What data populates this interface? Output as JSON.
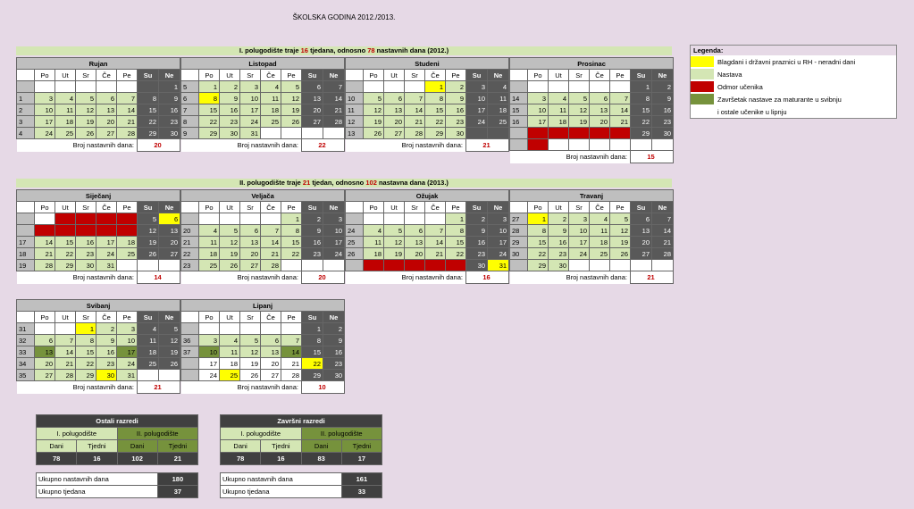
{
  "title": "ŠKOLSKA GODINA 2012./2013.",
  "sem1": {
    "pre": "I.  polugodište traje ",
    "w": "16",
    "mid": " tjedana, odnosno ",
    "d": "78",
    "post": " nastavnih dana (2012.)"
  },
  "sem2": {
    "pre": "II.  polugodište traje ",
    "w": "21",
    "mid": " tjedan, odnosno ",
    "d": "102",
    "post": " nastavna dana (2013.)"
  },
  "count_label": "Broj nastavnih dana:",
  "days": [
    "Po",
    "Ut",
    "Sr",
    "Če",
    "Pe",
    "Su",
    "Ne"
  ],
  "months": [
    {
      "name": "Rujan",
      "count": "20",
      "rows": [
        [
          "",
          "x",
          "x",
          "x",
          "x",
          "x",
          "w",
          "1:w"
        ],
        [
          "1",
          "3:n",
          "4:n",
          "5:n",
          "6:n",
          "7:n",
          "8:w",
          "9:w"
        ],
        [
          "2",
          "10:n",
          "11:n",
          "12:n",
          "13:n",
          "14:n",
          "15:w",
          "16:w"
        ],
        [
          "3",
          "17:n",
          "18:n",
          "19:n",
          "20:n",
          "21:n",
          "22:w",
          "23:w"
        ],
        [
          "4",
          "24:n",
          "25:n",
          "26:n",
          "27:n",
          "28:n",
          "29:w",
          "30:w"
        ]
      ]
    },
    {
      "name": "Listopad",
      "count": "22",
      "rows": [
        [
          "5",
          "1:n",
          "2:n",
          "3:n",
          "4:n",
          "5:n",
          "6:w",
          "7:w"
        ],
        [
          "6",
          "8:h",
          "9:n",
          "10:n",
          "11:n",
          "12:n",
          "13:w",
          "14:w"
        ],
        [
          "7",
          "15:n",
          "16:n",
          "17:n",
          "18:n",
          "19:n",
          "20:w",
          "21:w"
        ],
        [
          "8",
          "22:n",
          "23:n",
          "24:n",
          "25:n",
          "26:n",
          "27:w",
          "28:w"
        ],
        [
          "9",
          "29:n",
          "30:n",
          "31:n",
          "x",
          "x",
          "x",
          "x"
        ]
      ]
    },
    {
      "name": "Studeni",
      "count": "21",
      "rows": [
        [
          "",
          "x",
          "x",
          "x",
          "1:h",
          "2:n",
          "3:w",
          "4:w"
        ],
        [
          "10",
          "5:n",
          "6:n",
          "7:n",
          "8:n",
          "9:n",
          "10:w",
          "11:w"
        ],
        [
          "11",
          "12:n",
          "13:n",
          "14:n",
          "15:n",
          "16:n",
          "17:w",
          "18:w"
        ],
        [
          "12",
          "19:n",
          "20:n",
          "21:n",
          "22:n",
          "23:n",
          "24:w",
          "25:w"
        ],
        [
          "13",
          "26:n",
          "27:n",
          "28:n",
          "29:n",
          "30:n",
          "w",
          "w"
        ]
      ]
    },
    {
      "name": "Prosinac",
      "count": "15",
      "rows": [
        [
          "",
          "x",
          "x",
          "x",
          "x",
          "x",
          "1:w",
          "2:w"
        ],
        [
          "14",
          "3:n",
          "4:n",
          "5:n",
          "6:n",
          "7:n",
          "8:w",
          "9:w"
        ],
        [
          "15",
          "10:n",
          "11:n",
          "12:n",
          "13:n",
          "14:n",
          "15:w",
          "16:w"
        ],
        [
          "16",
          "17:n",
          "18:n",
          "19:n",
          "20:n",
          "21:n",
          "22:w",
          "23:w"
        ],
        [
          "",
          "24:o",
          "25:o",
          "26:o",
          "27:o",
          "28:o",
          "29:w",
          "30:w"
        ],
        [
          "",
          "31:o",
          "x",
          "x",
          "x",
          "x",
          "x",
          "x"
        ]
      ]
    },
    {
      "name": "Siječanj",
      "count": "14",
      "rows": [
        [
          "",
          "x",
          "1:o",
          "2:o",
          "3:o",
          "4:o",
          "5:w",
          "6:h"
        ],
        [
          "",
          "7:o",
          "8:o",
          "9:o",
          "10:o",
          "11:o",
          "12:w",
          "13:w"
        ],
        [
          "17",
          "14:n",
          "15:n",
          "16:n",
          "17:n",
          "18:n",
          "19:w",
          "20:w"
        ],
        [
          "18",
          "21:n",
          "22:n",
          "23:n",
          "24:n",
          "25:n",
          "26:w",
          "27:w"
        ],
        [
          "19",
          "28:n",
          "29:n",
          "30:n",
          "31:n",
          "x",
          "x",
          "x"
        ]
      ]
    },
    {
      "name": "Veljača",
      "count": "20",
      "rows": [
        [
          "",
          "x",
          "x",
          "x",
          "x",
          "1:n",
          "2:w",
          "3:w"
        ],
        [
          "20",
          "4:n",
          "5:n",
          "6:n",
          "7:n",
          "8:n",
          "9:w",
          "10:w"
        ],
        [
          "21",
          "11:n",
          "12:n",
          "13:n",
          "14:n",
          "15:n",
          "16:w",
          "17:w"
        ],
        [
          "22",
          "18:n",
          "19:n",
          "20:n",
          "21:n",
          "22:n",
          "23:w",
          "24:w"
        ],
        [
          "23",
          "25:n",
          "26:n",
          "27:n",
          "28:n",
          "x",
          "x",
          "x"
        ]
      ]
    },
    {
      "name": "Ožujak",
      "count": "16",
      "rows": [
        [
          "",
          "x",
          "x",
          "x",
          "x",
          "1:n",
          "2:w",
          "3:w"
        ],
        [
          "24",
          "4:n",
          "5:n",
          "6:n",
          "7:n",
          "8:n",
          "9:w",
          "10:w"
        ],
        [
          "25",
          "11:n",
          "12:n",
          "13:n",
          "14:n",
          "15:n",
          "16:w",
          "17:w"
        ],
        [
          "26",
          "18:n",
          "19:n",
          "20:n",
          "21:n",
          "22:n",
          "23:w",
          "24:w"
        ],
        [
          "",
          "25:o",
          "26:o",
          "27:o",
          "28:o",
          "29:o",
          "30:w",
          "31:h"
        ]
      ]
    },
    {
      "name": "Travanj",
      "count": "21",
      "rows": [
        [
          "27",
          "1:h",
          "2:n",
          "3:n",
          "4:n",
          "5:n",
          "6:w",
          "7:w"
        ],
        [
          "28",
          "8:n",
          "9:n",
          "10:n",
          "11:n",
          "12:n",
          "13:w",
          "14:w"
        ],
        [
          "29",
          "15:n",
          "16:n",
          "17:n",
          "18:n",
          "19:n",
          "20:w",
          "21:w"
        ],
        [
          "30",
          "22:n",
          "23:n",
          "24:n",
          "25:n",
          "26:n",
          "27:w",
          "28:w"
        ],
        [
          "",
          "29:n",
          "30:n",
          "x",
          "x",
          "x",
          "x",
          "x"
        ]
      ]
    },
    {
      "name": "Svibanj",
      "count": "21",
      "rows": [
        [
          "31",
          "x",
          "x",
          "1:h",
          "2:n",
          "3:n",
          "4:w",
          "5:w"
        ],
        [
          "32",
          "6:n",
          "7:n",
          "8:n",
          "9:n",
          "10:n",
          "11:w",
          "12:w"
        ],
        [
          "33",
          "13:g",
          "14:n",
          "15:n",
          "16:n",
          "17:g",
          "18:w",
          "19:w"
        ],
        [
          "34",
          "20:n",
          "21:n",
          "22:n",
          "23:n",
          "24:n",
          "25:w",
          "26:w"
        ],
        [
          "35",
          "27:n",
          "28:n",
          "29:n",
          "30:h",
          "31:n",
          "x",
          "x"
        ]
      ]
    },
    {
      "name": "Lipanj",
      "count": "10",
      "rows": [
        [
          "",
          "x",
          "x",
          "x",
          "x",
          "x",
          "1:w",
          "2:w"
        ],
        [
          "36",
          "3:n",
          "4:n",
          "5:n",
          "6:n",
          "7:n",
          "8:w",
          "9:w"
        ],
        [
          "37",
          "10:g",
          "11:n",
          "12:n",
          "13:n",
          "14:g",
          "15:w",
          "16:w"
        ],
        [
          "",
          "17:x",
          "18:x",
          "19:x",
          "20:x",
          "21:x",
          "22:h",
          "23:w"
        ],
        [
          "",
          "24:x",
          "25:h",
          "26:x",
          "27:x",
          "28:x",
          "29:w",
          "30:w"
        ]
      ]
    }
  ],
  "legend": {
    "title": "Legenda:",
    "items": [
      {
        "color": "#ffff00",
        "label": "Blagdani i državni praznici u RH - neradni dani"
      },
      {
        "color": "#d4e6b4",
        "label": "Nastava"
      },
      {
        "color": "#c00000",
        "label": "Odmor učenika"
      },
      {
        "color": "#76923c",
        "label": "Završetak nastave za maturante u svibnju"
      },
      {
        "color": "#ffffff",
        "label": "i ostale učenike u lipnju"
      }
    ]
  },
  "summaries": [
    {
      "title": "Ostali razredi",
      "p1": "I. polugodište",
      "p2": "II. polugodište",
      "dani": "Dani",
      "tjedni": "Tjedni",
      "v": [
        "78",
        "16",
        "102",
        "21"
      ],
      "total_days_label": "Ukupno nastavnih dana",
      "total_days": "180",
      "total_weeks_label": "Ukupno tjedana",
      "total_weeks": "37"
    },
    {
      "title": "Završni razredi",
      "p1": "I. polugodište",
      "p2": "II. polugodište",
      "dani": "Dani",
      "tjedni": "Tjedni",
      "v": [
        "78",
        "16",
        "83",
        "17"
      ],
      "total_days_label": "Ukupno nastavnih dana",
      "total_days": "161",
      "total_weeks_label": "Ukupno tjedana",
      "total_weeks": "33"
    }
  ]
}
